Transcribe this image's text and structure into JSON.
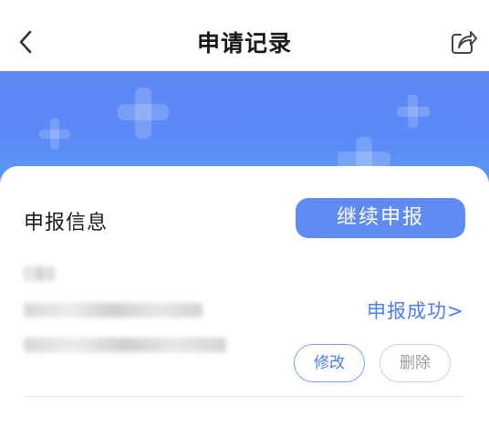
{
  "header": {
    "title": "申请记录",
    "back_icon": "chevron-left-icon",
    "share_icon": "share-icon"
  },
  "banner": {
    "color": "#5f87f4",
    "decoration_icon": "plus-icon"
  },
  "record": {
    "section_title": "申报信息",
    "continue_label": "继续申报",
    "status_label": "申报成功>",
    "edit_label": "修改",
    "delete_label": "删除"
  },
  "colors": {
    "accent": "#5f8bf2",
    "link": "#4a80ee",
    "text": "#1a1a1a",
    "muted": "#9b9b9b"
  }
}
